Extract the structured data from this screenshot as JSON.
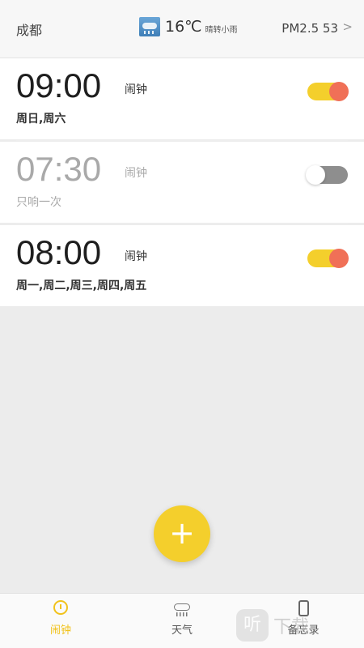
{
  "header": {
    "city": "成都",
    "temperature": "16℃",
    "weather_desc": "晴转小雨",
    "pm25": "PM2.5 53",
    "chevron": ">"
  },
  "alarms": [
    {
      "time": "09:00",
      "label": "闹钟",
      "repeat": "周日,周六",
      "enabled": true
    },
    {
      "time": "07:30",
      "label": "闹钟",
      "repeat": "只响一次",
      "enabled": false
    },
    {
      "time": "08:00",
      "label": "闹钟",
      "repeat": "周一,周二,周三,周四,周五",
      "enabled": true
    }
  ],
  "fab": {
    "label": "+"
  },
  "tabs": [
    {
      "label": "闹钟",
      "icon": "alarm-clock-icon",
      "active": true
    },
    {
      "label": "天气",
      "icon": "weather-icon",
      "active": false
    },
    {
      "label": "备忘录",
      "icon": "memo-icon",
      "active": false
    }
  ],
  "watermark": {
    "text": "下载",
    "logo": "听"
  },
  "colors": {
    "accent": "#f4cf2c",
    "toggle_knob_on": "#f07057",
    "toggle_off": "#8e8e8e",
    "background": "#ececec"
  }
}
